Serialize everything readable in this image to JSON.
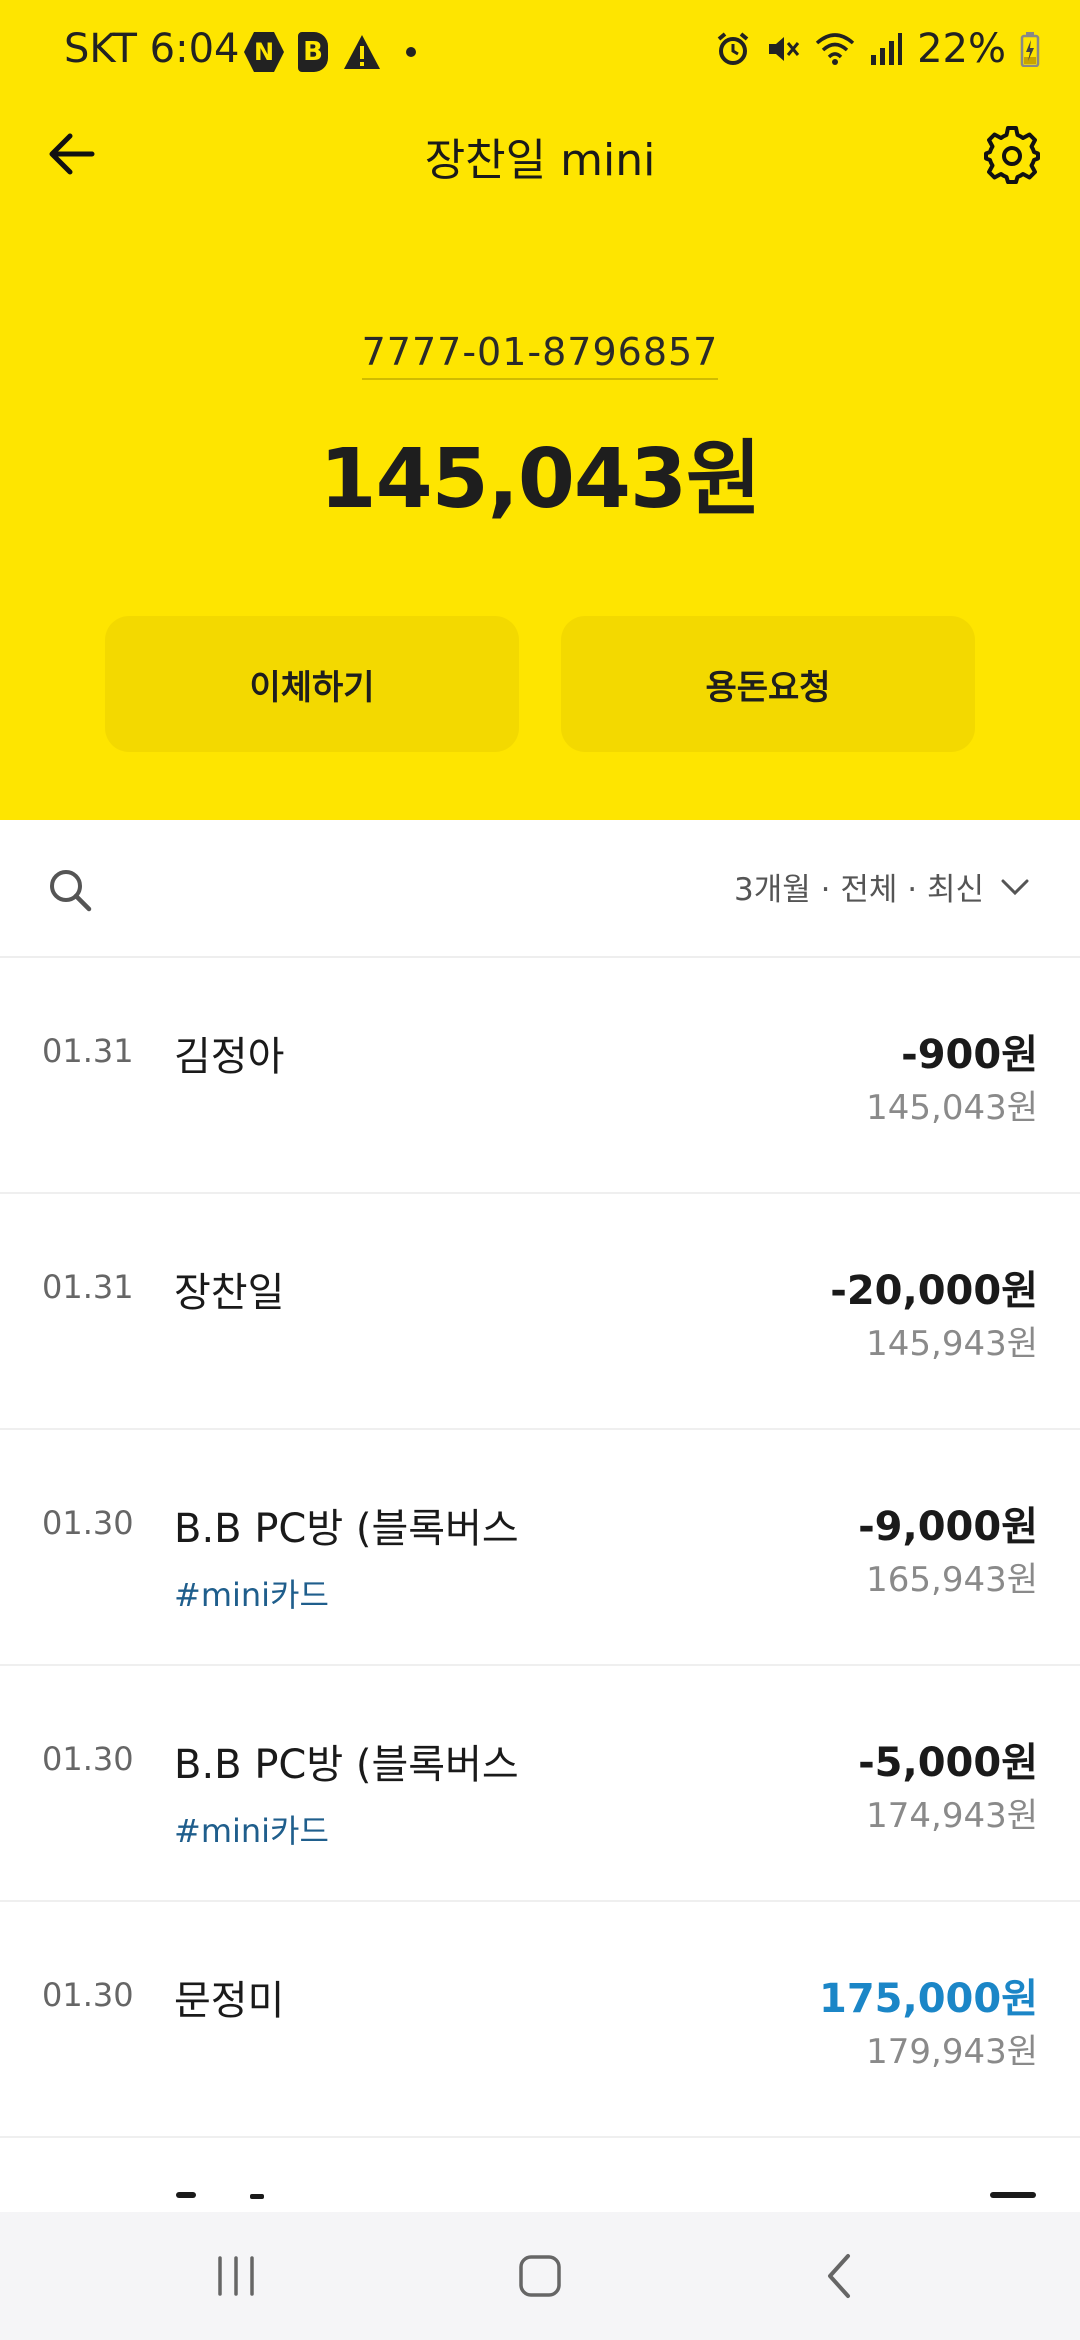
{
  "status_bar": {
    "carrier_time": "SKT 6:04",
    "notif_n": "N",
    "notif_b": "B",
    "battery": "22%"
  },
  "header": {
    "title": "장찬일 mini"
  },
  "account": {
    "number": "7777-01-8796857",
    "balance": "145,043원"
  },
  "actions": {
    "transfer": "이체하기",
    "request": "용돈요청"
  },
  "filter": {
    "label": "3개월 · 전체 · 최신"
  },
  "transactions": [
    {
      "date": "01.31",
      "name": "김정아",
      "tag": "",
      "amount": "-900원",
      "balance": "145,043원"
    },
    {
      "date": "01.31",
      "name": "장찬일",
      "tag": "",
      "amount": "-20,000원",
      "balance": "145,943원"
    },
    {
      "date": "01.30",
      "name": "B.B PC방 (블록버스",
      "tag": "#mini카드",
      "amount": "-9,000원",
      "balance": "165,943원"
    },
    {
      "date": "01.30",
      "name": "B.B PC방 (블록버스",
      "tag": "#mini카드",
      "amount": "-5,000원",
      "balance": "174,943원"
    },
    {
      "date": "01.30",
      "name": "문정미",
      "tag": "",
      "amount": "175,000원",
      "balance": "179,943원"
    }
  ],
  "colors": {
    "brand_yellow": "#FEE500",
    "button_yellow": "#F3D900",
    "deposit_blue": "#1b86c7",
    "tag_blue": "#1f5e8c"
  }
}
